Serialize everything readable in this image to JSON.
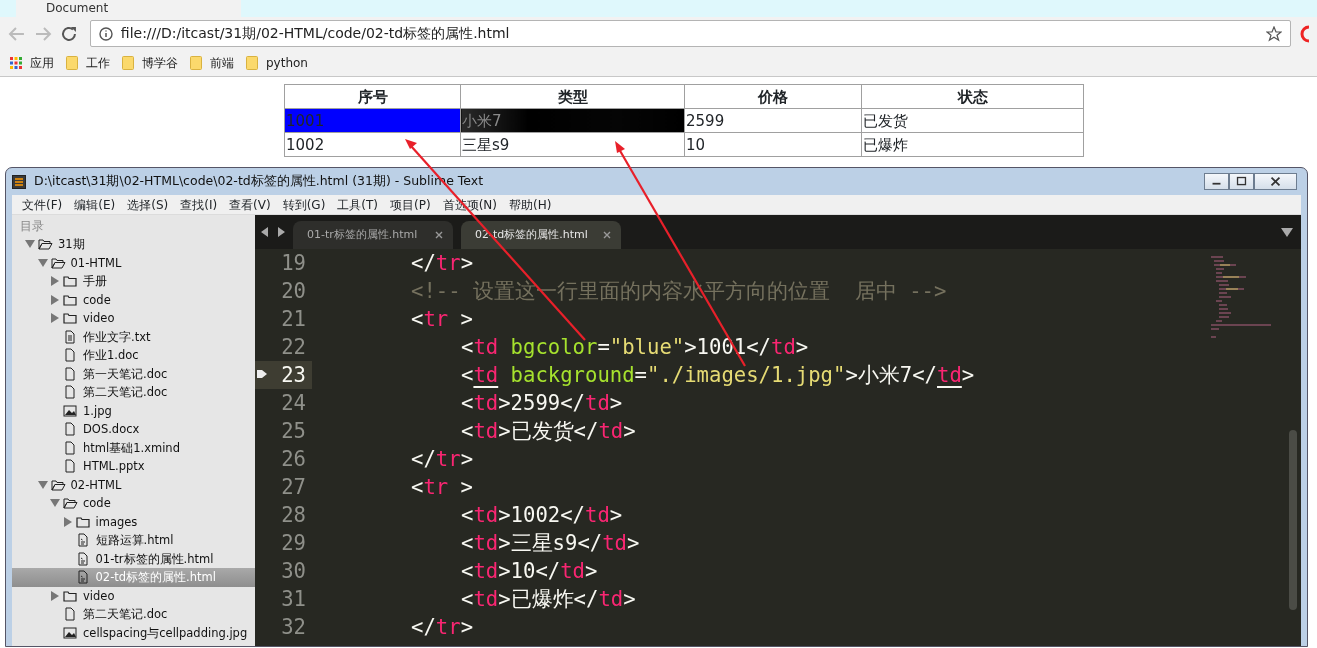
{
  "browser": {
    "tab_title": "Document",
    "address": "file:///D:/itcast/31期/02-HTML/code/02-td标签的属性.html",
    "bookmarks": [
      {
        "kind": "apps",
        "label": "应用"
      },
      {
        "kind": "folder",
        "label": "工作"
      },
      {
        "kind": "folder",
        "label": "博学谷"
      },
      {
        "kind": "folder",
        "label": "前端"
      },
      {
        "kind": "folder",
        "label": "python"
      }
    ]
  },
  "table": {
    "columns": [
      "序号",
      "类型",
      "价格",
      "状态"
    ],
    "rows": [
      [
        {
          "text": "1001",
          "kind": "color",
          "color": "#0000ff"
        },
        {
          "text": "小米7",
          "kind": "image"
        },
        {
          "text": "2599",
          "kind": "plain"
        },
        {
          "text": "已发货",
          "kind": "plain"
        }
      ],
      [
        {
          "text": "1002",
          "kind": "plain"
        },
        {
          "text": "三星s9",
          "kind": "plain"
        },
        {
          "text": "10",
          "kind": "plain"
        },
        {
          "text": "已爆炸",
          "kind": "plain"
        }
      ]
    ]
  },
  "editor": {
    "title": "D:\\itcast\\31期\\02-HTML\\code\\02-td标签的属性.html (31期) - Sublime Text",
    "menu": [
      "文件(F)",
      "编辑(E)",
      "选择(S)",
      "查找(I)",
      "查看(V)",
      "转到(G)",
      "工具(T)",
      "项目(P)",
      "首选项(N)",
      "帮助(H)"
    ],
    "sidebar": {
      "heading": "目录",
      "tree": [
        {
          "label": "31期",
          "kind": "folder",
          "expanded": true,
          "selected": false,
          "children": [
            {
              "label": "01-HTML",
              "kind": "folder",
              "expanded": true,
              "selected": false,
              "children": [
                {
                  "label": "手册",
                  "kind": "folder",
                  "expanded": false,
                  "selected": false
                },
                {
                  "label": "code",
                  "kind": "folder",
                  "expanded": false,
                  "selected": false
                },
                {
                  "label": "video",
                  "kind": "folder",
                  "expanded": false,
                  "selected": false
                },
                {
                  "label": "作业文字.txt",
                  "kind": "text",
                  "selected": false
                },
                {
                  "label": "作业1.doc",
                  "kind": "file",
                  "selected": false
                },
                {
                  "label": "第一天笔记.doc",
                  "kind": "file",
                  "selected": false
                },
                {
                  "label": "第二天笔记.doc",
                  "kind": "file",
                  "selected": false
                },
                {
                  "label": "1.jpg",
                  "kind": "image",
                  "selected": false
                },
                {
                  "label": "DOS.docx",
                  "kind": "file",
                  "selected": false
                },
                {
                  "label": "html基础1.xmind",
                  "kind": "file",
                  "selected": false
                },
                {
                  "label": "HTML.pptx",
                  "kind": "file",
                  "selected": false
                }
              ]
            },
            {
              "label": "02-HTML",
              "kind": "folder",
              "expanded": true,
              "selected": false,
              "children": [
                {
                  "label": "code",
                  "kind": "folder",
                  "expanded": true,
                  "selected": false,
                  "children": [
                    {
                      "label": "images",
                      "kind": "folder",
                      "expanded": false,
                      "selected": false
                    },
                    {
                      "label": "短路运算.html",
                      "kind": "html",
                      "selected": false
                    },
                    {
                      "label": "01-tr标签的属性.html",
                      "kind": "html",
                      "selected": false
                    },
                    {
                      "label": "02-td标签的属性.html",
                      "kind": "html",
                      "selected": true
                    }
                  ]
                },
                {
                  "label": "video",
                  "kind": "folder",
                  "expanded": false,
                  "selected": false
                },
                {
                  "label": "第二天笔记.doc",
                  "kind": "file",
                  "selected": false
                },
                {
                  "label": "cellspacing与cellpadding.jpg",
                  "kind": "image",
                  "selected": false
                }
              ]
            }
          ]
        }
      ]
    },
    "tabs": [
      {
        "label": "01-tr标签的属性.html",
        "selected": false
      },
      {
        "label": "02-td标签的属性.html",
        "selected": true
      }
    ],
    "lines": [
      {
        "number": "19",
        "kind": "row",
        "current": false,
        "bookmarked": false,
        "tokens": [
          {
            "kind": "plain",
            "text": "</"
          },
          {
            "kind": "tag",
            "text": "tr"
          },
          {
            "kind": "plain",
            "text": ">"
          }
        ]
      },
      {
        "number": "20",
        "kind": "row",
        "current": false,
        "bookmarked": false,
        "tokens": [
          {
            "kind": "comment",
            "text": "<!-- 设置这一行里面的内容水平方向的位置  居中 -->"
          }
        ]
      },
      {
        "number": "21",
        "kind": "row",
        "current": false,
        "bookmarked": false,
        "tokens": [
          {
            "kind": "plain",
            "text": "<"
          },
          {
            "kind": "tag",
            "text": "tr"
          },
          {
            "kind": "plain",
            "text": " >"
          }
        ]
      },
      {
        "number": "22",
        "kind": "cell",
        "current": false,
        "bookmarked": false,
        "tokens": [
          {
            "kind": "plain",
            "text": "<"
          },
          {
            "kind": "tag",
            "text": "td"
          },
          {
            "kind": "attr",
            "text": "bgcolor"
          },
          {
            "kind": "plain",
            "text": "="
          },
          {
            "kind": "string",
            "text": "\"blue\""
          },
          {
            "kind": "plain",
            "text": ">1001</"
          },
          {
            "kind": "tag",
            "text": "td"
          },
          {
            "kind": "plain",
            "text": ">"
          }
        ]
      },
      {
        "number": "23",
        "kind": "cell",
        "current": true,
        "bookmarked": true,
        "tokens": [
          {
            "kind": "plain",
            "text": "<"
          },
          {
            "kind": "tag_match",
            "text": "td"
          },
          {
            "kind": "attr",
            "text": "background"
          },
          {
            "kind": "plain",
            "text": "="
          },
          {
            "kind": "string",
            "text": "\"./images/1.jpg\""
          },
          {
            "kind": "plain",
            "text": ">小米7</"
          },
          {
            "kind": "tag_match",
            "text": "td"
          },
          {
            "kind": "plain",
            "text": ">"
          }
        ]
      },
      {
        "number": "24",
        "kind": "cell",
        "current": false,
        "bookmarked": false,
        "tokens": [
          {
            "kind": "plain",
            "text": "<"
          },
          {
            "kind": "tag",
            "text": "td"
          },
          {
            "kind": "plain",
            "text": ">2599</"
          },
          {
            "kind": "tag",
            "text": "td"
          },
          {
            "kind": "plain",
            "text": ">"
          }
        ]
      },
      {
        "number": "25",
        "kind": "cell",
        "current": false,
        "bookmarked": false,
        "tokens": [
          {
            "kind": "plain",
            "text": "<"
          },
          {
            "kind": "tag",
            "text": "td"
          },
          {
            "kind": "plain",
            "text": ">已发货</"
          },
          {
            "kind": "tag",
            "text": "td"
          },
          {
            "kind": "plain",
            "text": ">"
          }
        ]
      },
      {
        "number": "26",
        "kind": "row",
        "current": false,
        "bookmarked": false,
        "tokens": [
          {
            "kind": "plain",
            "text": "</"
          },
          {
            "kind": "tag",
            "text": "tr"
          },
          {
            "kind": "plain",
            "text": ">"
          }
        ]
      },
      {
        "number": "27",
        "kind": "row",
        "current": false,
        "bookmarked": false,
        "tokens": [
          {
            "kind": "plain",
            "text": "<"
          },
          {
            "kind": "tag",
            "text": "tr"
          },
          {
            "kind": "plain",
            "text": " >"
          }
        ]
      },
      {
        "number": "28",
        "kind": "cell",
        "current": false,
        "bookmarked": false,
        "tokens": [
          {
            "kind": "plain",
            "text": "<"
          },
          {
            "kind": "tag",
            "text": "td"
          },
          {
            "kind": "plain",
            "text": ">1002</"
          },
          {
            "kind": "tag",
            "text": "td"
          },
          {
            "kind": "plain",
            "text": ">"
          }
        ]
      },
      {
        "number": "29",
        "kind": "cell",
        "current": false,
        "bookmarked": false,
        "tokens": [
          {
            "kind": "plain",
            "text": "<"
          },
          {
            "kind": "tag",
            "text": "td"
          },
          {
            "kind": "plain",
            "text": ">三星s9</"
          },
          {
            "kind": "tag",
            "text": "td"
          },
          {
            "kind": "plain",
            "text": ">"
          }
        ]
      },
      {
        "number": "30",
        "kind": "cell",
        "current": false,
        "bookmarked": false,
        "tokens": [
          {
            "kind": "plain",
            "text": "<"
          },
          {
            "kind": "tag",
            "text": "td"
          },
          {
            "kind": "plain",
            "text": ">10</"
          },
          {
            "kind": "tag",
            "text": "td"
          },
          {
            "kind": "plain",
            "text": ">"
          }
        ]
      },
      {
        "number": "31",
        "kind": "cell",
        "current": false,
        "bookmarked": false,
        "tokens": [
          {
            "kind": "plain",
            "text": "<"
          },
          {
            "kind": "tag",
            "text": "td"
          },
          {
            "kind": "plain",
            "text": ">已爆炸</"
          },
          {
            "kind": "tag",
            "text": "td"
          },
          {
            "kind": "plain",
            "text": ">"
          }
        ]
      },
      {
        "number": "32",
        "kind": "row",
        "current": false,
        "bookmarked": false,
        "tokens": [
          {
            "kind": "plain",
            "text": "</"
          },
          {
            "kind": "tag",
            "text": "tr"
          },
          {
            "kind": "plain",
            "text": ">"
          }
        ]
      }
    ]
  }
}
